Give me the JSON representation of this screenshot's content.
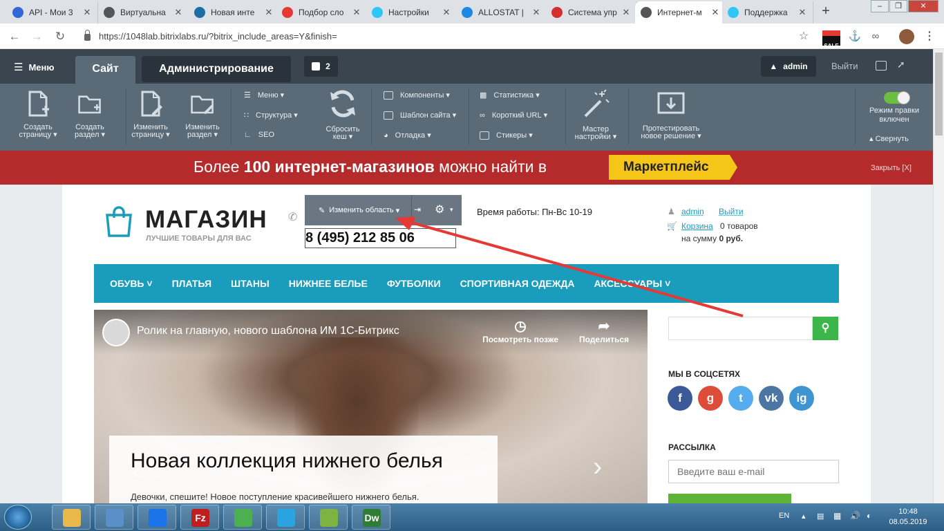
{
  "browser": {
    "tabs": [
      {
        "title": "API - Мои 3",
        "icon": "globe-icon",
        "color": "#3367d6",
        "active": false
      },
      {
        "title": "Виртуальна",
        "icon": "globe-icon",
        "color": "#555555",
        "active": false
      },
      {
        "title": "Новая инте",
        "icon": "app-icon",
        "color": "#1c6ea4",
        "active": false
      },
      {
        "title": "Подбор сло",
        "icon": "chart-icon",
        "color": "#e53935",
        "active": false
      },
      {
        "title": "Настройки",
        "icon": "bitrix24-icon",
        "color": "#2fc6f6",
        "active": false
      },
      {
        "title": "ALLOSTAT |",
        "icon": "phone-icon",
        "color": "#1e88e5",
        "active": false
      },
      {
        "title": "Система упр",
        "icon": "target-icon",
        "color": "#d32f2f",
        "active": false
      },
      {
        "title": "Интернет-м",
        "icon": "globe-icon",
        "color": "#555555",
        "active": true
      },
      {
        "title": "Поддержка",
        "icon": "bitrix24-icon",
        "color": "#2fc6f6",
        "active": false
      }
    ],
    "new_tab": "+",
    "url": "https://1048lab.bitrixlabs.ru/?bitrix_include_areas=Y&finish=",
    "sale_badge": "SALE"
  },
  "bitrix_panel": {
    "menu_label": "Меню",
    "tab_site": "Сайт",
    "tab_admin": "Администрирование",
    "notifications_count": "2",
    "user": "admin",
    "logout": "Выйти",
    "tools": [
      {
        "label1": "Создать",
        "label2": "страницу",
        "icon": "page-add-icon"
      },
      {
        "label1": "Создать",
        "label2": "раздел",
        "icon": "folder-add-icon"
      },
      {
        "label1": "Изменить",
        "label2": "страницу",
        "icon": "page-edit-icon"
      },
      {
        "label1": "Изменить",
        "label2": "раздел",
        "icon": "folder-edit-icon"
      }
    ],
    "mid_items_1": [
      "Меню",
      "Структура",
      "SEO"
    ],
    "reset_cache": {
      "label1": "Сбросить",
      "label2": "кеш"
    },
    "mid_items_2": [
      "Компоненты",
      "Шаблон сайта",
      "Отладка"
    ],
    "mid_items_3": [
      "Статистика",
      "Короткий URL",
      "Стикеры"
    ],
    "wizard": {
      "label1": "Мастер",
      "label2": "настройки"
    },
    "test_solution": {
      "label1": "Протестировать",
      "label2": "новое решение"
    },
    "edit_mode": {
      "label1": "Режим правки",
      "label2": "включен"
    },
    "collapse": "Свернуть"
  },
  "banner": {
    "text_prefix": "Более ",
    "text_bold": "100 интернет-магазинов",
    "text_suffix": " можно найти в",
    "button": "Маркетплейс",
    "close": "Закрыть [X]"
  },
  "site": {
    "logo_title": "МАГАЗИН",
    "logo_subtitle": "ЛУЧШИЕ ТОВАРЫ ДЛЯ ВАС",
    "edit_area_label": "Изменить область",
    "phone": "8 (495) 212 85 06",
    "working_hours": "Время работы: Пн-Вс 10-19",
    "user_link": "admin",
    "logout_link": "Выйти",
    "cart_link": "Корзина",
    "cart_count": "0 товаров",
    "cart_sum_prefix": "на сумму ",
    "cart_sum": "0 руб.",
    "menu": [
      "ОБУВЬ",
      "ПЛАТЬЯ",
      "ШТАНЫ",
      "НИЖНЕЕ БЕЛЬЕ",
      "ФУТБОЛКИ",
      "СПОРТИВНАЯ ОДЕЖДА",
      "АКСЕССУАРЫ"
    ],
    "video_title": "Ролик на главную, нового шаблона ИМ 1С-Битрикс",
    "watch_later": "Посмотреть позже",
    "share": "Поделиться",
    "slide_heading": "Новая коллекция нижнего белья",
    "slide_text": "Девочки, спешите! Новое поступление красивейшего нижнего белья.",
    "social_heading": "МЫ В СОЦСЕТЯХ",
    "socials": [
      {
        "letter": "f",
        "color": "#3b5998",
        "icon": "facebook-icon"
      },
      {
        "letter": "g",
        "color": "#dd4b39",
        "icon": "google-plus-icon"
      },
      {
        "letter": "t",
        "color": "#55acee",
        "icon": "twitter-icon"
      },
      {
        "letter": "vk",
        "color": "#4c75a3",
        "icon": "vk-icon"
      },
      {
        "letter": "ig",
        "color": "#3f94d2",
        "icon": "instagram-icon"
      }
    ],
    "newsletter_heading": "РАССЫЛКА",
    "email_placeholder": "Введите ваш e-mail"
  },
  "taskbar": {
    "lang": "EN",
    "time": "10:48",
    "date": "08.05.2019",
    "apps": [
      {
        "icon": "file-explorer-icon",
        "color": "#e8b84a",
        "label": ""
      },
      {
        "icon": "snipping-tool-icon",
        "color": "#5b8fc9",
        "label": ""
      },
      {
        "icon": "maps-icon",
        "color": "#1a73e8",
        "label": ""
      },
      {
        "icon": "filezilla-icon",
        "color": "#bf1e1e",
        "label": "Fz"
      },
      {
        "icon": "chrome-icon",
        "color": "#4caf50",
        "label": ""
      },
      {
        "icon": "telegram-icon",
        "color": "#2aa3e0",
        "label": ""
      },
      {
        "icon": "notepad-icon",
        "color": "#7cb342",
        "label": ""
      },
      {
        "icon": "dreamweaver-icon",
        "color": "#2e7d32",
        "label": "Dw"
      }
    ]
  }
}
